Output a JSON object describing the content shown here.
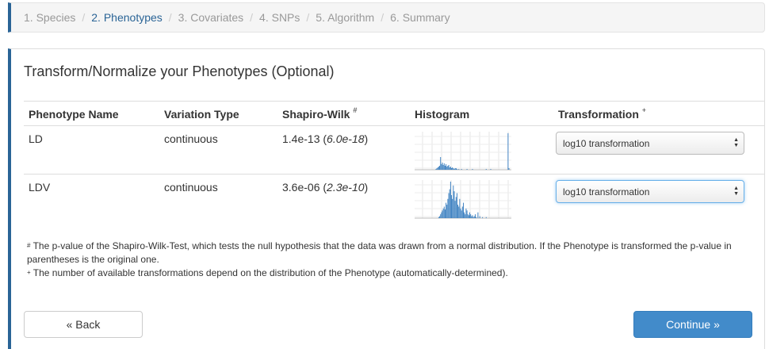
{
  "breadcrumbs": [
    {
      "label": "1. Species",
      "active": false
    },
    {
      "label": "2. Phenotypes",
      "active": true
    },
    {
      "label": "3. Covariates",
      "active": false
    },
    {
      "label": "4. SNPs",
      "active": false
    },
    {
      "label": "5. Algorithm",
      "active": false
    },
    {
      "label": "6. Summary",
      "active": false
    }
  ],
  "breadcrumb_separator": "/",
  "panel": {
    "title": "Transform/Normalize your Phenotypes (Optional)"
  },
  "table": {
    "headers": {
      "name": "Phenotype Name",
      "variation": "Variation Type",
      "shapiro": "Shapiro-Wilk",
      "shapiro_mark": "#",
      "histogram": "Histogram",
      "transformation": "Transformation",
      "transformation_mark": "+"
    },
    "rows": [
      {
        "name": "LD",
        "variation": "continuous",
        "pvalue": "1.4e-13",
        "original": "6.0e-18",
        "transformation": "log10 transformation"
      },
      {
        "name": "LDV",
        "variation": "continuous",
        "pvalue": "3.6e-06",
        "original": "2.3e-10",
        "transformation": "log10 transformation"
      }
    ]
  },
  "footnotes": {
    "mark1": "#",
    "note1": "The p-value of the Shapiro-Wilk-Test, which tests the null hypothesis that the data was drawn from a normal distribution. If the Phenotype is transformed the p-value in parentheses is the original one.",
    "mark2": "+",
    "note2": "The number of available transformations depend on the distribution of the Phenotype (automatically-determined)."
  },
  "buttons": {
    "back": "« Back",
    "continue": "Continue »"
  },
  "colors": {
    "accent": "#2a6496",
    "primary_button": "#428bca",
    "histogram_bar": "#3a7fc0"
  }
}
